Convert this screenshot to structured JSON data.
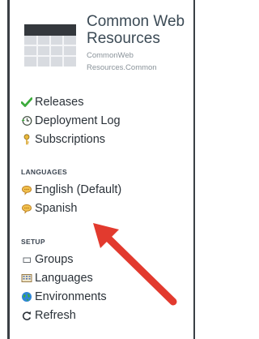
{
  "header": {
    "title": "Common Web Resources",
    "subtitle_line1": "CommonWeb",
    "subtitle_line2": "Resources.Common"
  },
  "nav": {
    "releases": "Releases",
    "deployment_log": "Deployment Log",
    "subscriptions": "Subscriptions",
    "languages_section": "LANGUAGES",
    "english": "English (Default)",
    "spanish": "Spanish",
    "setup_section": "SETUP",
    "groups": "Groups",
    "languages": "Languages",
    "environments": "Environments",
    "refresh": "Refresh"
  },
  "icons": {
    "releases": "checkmark-icon",
    "deployment_log": "history-clock-icon",
    "subscriptions": "key-icon",
    "english": "speech-bubble-icon",
    "spanish": "speech-bubble-icon",
    "groups": "folder-outline-icon",
    "languages": "grid-icon",
    "environments": "globe-icon",
    "refresh": "refresh-icon"
  },
  "colors": {
    "accent_green": "#3cab3b",
    "bubble_orange": "#e9a23b",
    "arrow_red": "#e23a2e",
    "globe_blue": "#2f86d6"
  }
}
